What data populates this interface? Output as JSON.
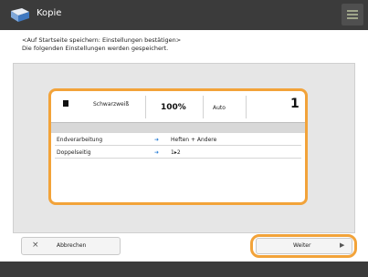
{
  "header": {
    "title": "Kopie"
  },
  "instruction": {
    "line1": "<Auf Startseite speichern: Einstellungen bestätigen>",
    "line2": "Die folgenden Einstellungen werden gespeichert."
  },
  "summary": {
    "color_mode": "Schwarzweiß",
    "ratio": "100%",
    "paper": "Auto",
    "copies": "1"
  },
  "settings": [
    {
      "name": "Endverarbeitung",
      "value": "Heften + Andere"
    },
    {
      "name": "Doppelseitig",
      "value": "1▸2"
    }
  ],
  "buttons": {
    "cancel": "Abbrechen",
    "next": "Weiter"
  },
  "colors": {
    "highlight": "#f2a33a",
    "header": "#3b3b3b",
    "panel": "#e6e6e6"
  }
}
